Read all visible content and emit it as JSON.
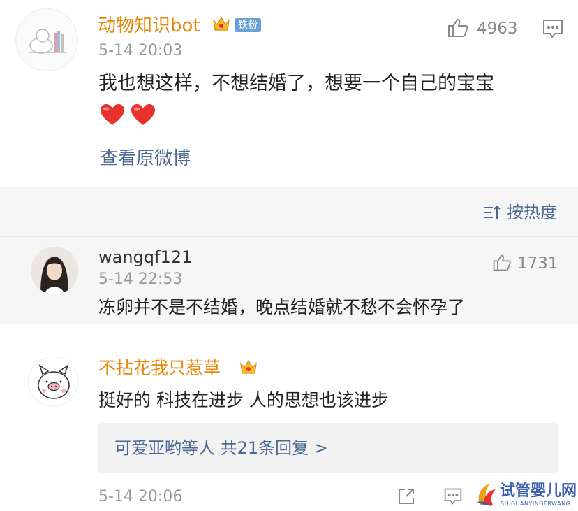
{
  "post": {
    "author": "动物知识bot",
    "badge": "铁粉",
    "time": "5-14 20:03",
    "like_count": "4963",
    "text": "我也想这样，不想结婚了，想要一个自己的宝宝",
    "view_original": "查看原微博"
  },
  "sort": {
    "label": "按热度"
  },
  "comments": [
    {
      "author": "wangqf121",
      "time": "5-14 22:53",
      "like_count": "1731",
      "text": "冻卵并不是不结婚，晚点结婚就不愁不会怀孕了"
    },
    {
      "author": "不拈花我只惹草",
      "text": "挺好的 科技在进步 人的思想也该进步",
      "replies_link": "可爱亚哟等人  共21条回复 >",
      "time": "5-14 20:06"
    }
  ],
  "watermark": {
    "title": "试管婴儿网",
    "subtitle": "SHIGUANYINGERWANG"
  },
  "colors": {
    "author_orange": "#e8890c",
    "link_blue": "#4a6a94",
    "heart_red": "#e8322e",
    "badge_blue": "#6aa0d8"
  }
}
